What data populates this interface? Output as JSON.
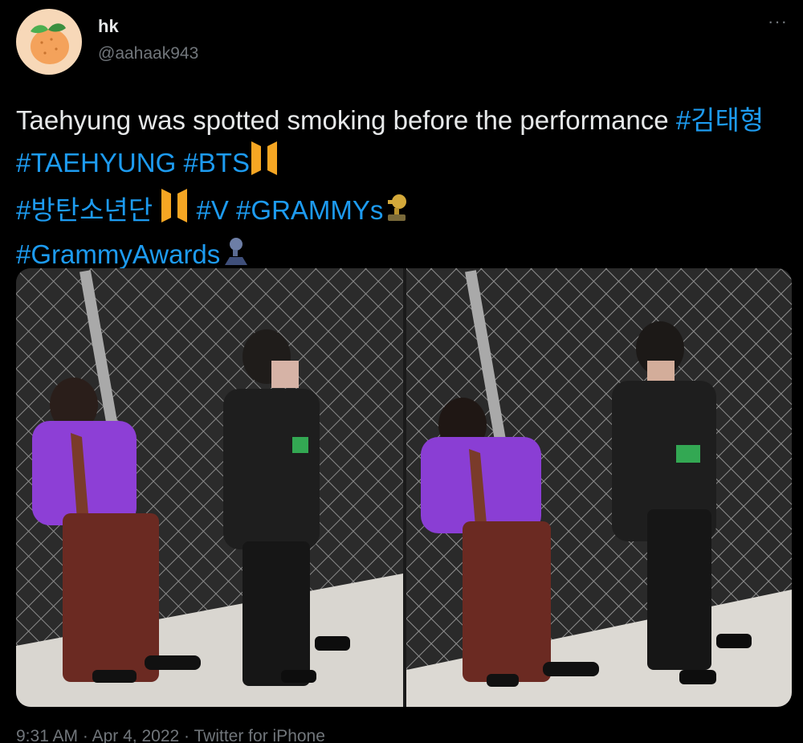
{
  "user": {
    "name": "hk",
    "handle": "@aahaak943"
  },
  "more_label": "···",
  "tweet": {
    "text_before": "Taehyung was spotted smoking before the performance",
    "hashtags": [
      "#김태형",
      "#TAEHYUNG",
      "#BTS",
      "#방탄소년단",
      "#V",
      "#GRAMMYs",
      "#GrammyAwards"
    ]
  },
  "meta": {
    "time": "9:31 AM",
    "date": "Apr 4, 2022",
    "source": "Twitter for iPhone",
    "separator": "·"
  },
  "colors": {
    "background": "#000000",
    "text": "#e7e9ea",
    "secondary": "#71767b",
    "link": "#1d9bf0"
  },
  "icons": [
    "orange-avatar-icon",
    "more-options-icon",
    "bts-logo-icon",
    "grammy-trophy-icon"
  ]
}
